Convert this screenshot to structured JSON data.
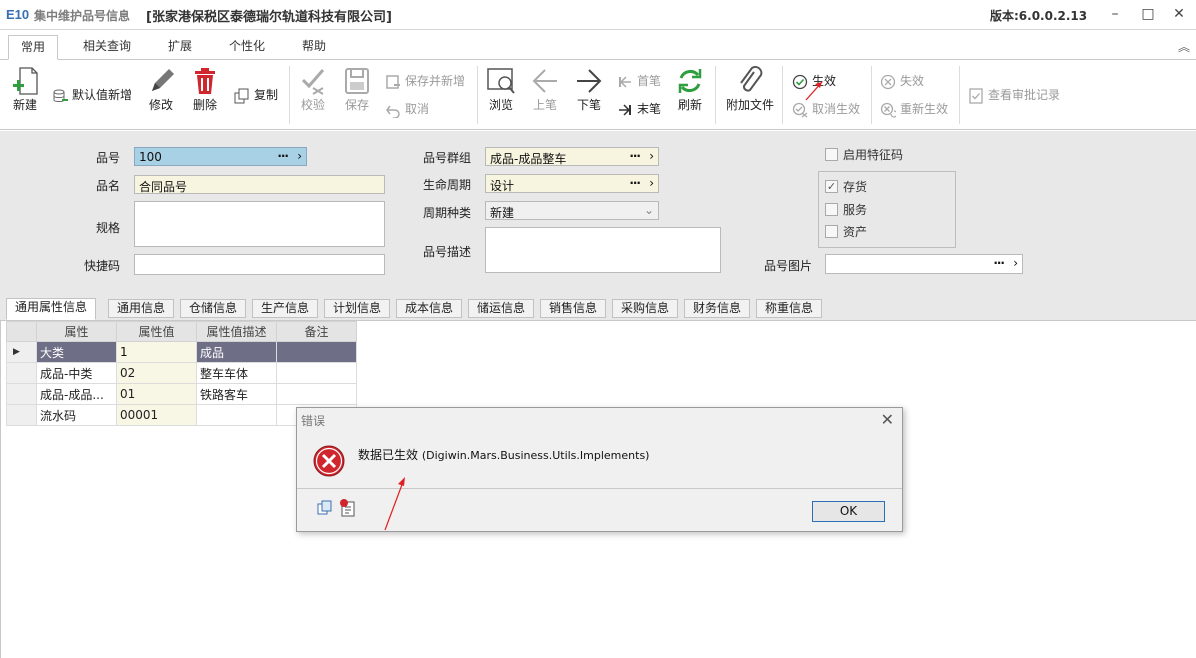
{
  "titlebar": {
    "logo": "E10",
    "app_title": "集中维护品号信息",
    "company": "[张家港保税区泰德瑞尔轨道科技有限公司]",
    "version": "版本:6.0.0.2.13",
    "minimize": "–",
    "maximize": "□",
    "close": "✕"
  },
  "menu": {
    "tabs": [
      "常用",
      "相关查询",
      "扩展",
      "个性化",
      "帮助"
    ],
    "active": "常用"
  },
  "ribbon": {
    "new": "新建",
    "default_new": "默认值新增",
    "edit": "修改",
    "delete": "删除",
    "copy": "复制",
    "check": "校验",
    "save": "保存",
    "save_and_new": "保存并新增",
    "cancel": "取消",
    "browse": "浏览",
    "prev": "上笔",
    "next": "下笔",
    "first": "首笔",
    "last": "末笔",
    "refresh": "刷新",
    "attach": "附加文件",
    "activate": "生效",
    "cancel_activate": "取消生效",
    "invalidate": "失效",
    "reactivate": "重新生效",
    "view_approval": "查看审批记录"
  },
  "form": {
    "item_no_label": "品号",
    "item_no_value": "100",
    "item_name_label": "品名",
    "item_name_value": "合同品号",
    "spec_label": "规格",
    "spec_value": "",
    "shortcut_label": "快捷码",
    "shortcut_value": "",
    "group_label": "品号群组",
    "group_value": "成品-成品整车",
    "lifecycle_label": "生命周期",
    "lifecycle_value": "设计",
    "cycle_type_label": "周期种类",
    "cycle_type_value": "新建",
    "desc_label": "品号描述",
    "desc_value": "",
    "feature_code_label": "启用特征码",
    "feature_code_checked": false,
    "inventory_label": "存货",
    "inventory_checked": true,
    "service_label": "服务",
    "service_checked": false,
    "asset_label": "资产",
    "asset_checked": false,
    "image_label": "品号图片",
    "image_value": ""
  },
  "subtabs": [
    "通用属性信息",
    "通用信息",
    "仓储信息",
    "生产信息",
    "计划信息",
    "成本信息",
    "储运信息",
    "销售信息",
    "采购信息",
    "财务信息",
    "称重信息"
  ],
  "grid": {
    "headers": [
      "属性",
      "属性值",
      "属性值描述",
      "备注"
    ],
    "rows": [
      {
        "marker": "▶",
        "attr": "大类",
        "value": "1",
        "desc": "成品",
        "note": ""
      },
      {
        "marker": "",
        "attr": "成品-中类",
        "value": "02",
        "desc": "整车车体",
        "note": ""
      },
      {
        "marker": "",
        "attr": "成品-成品...",
        "value": "01",
        "desc": "铁路客车",
        "note": ""
      },
      {
        "marker": "",
        "attr": "流水码",
        "value": "00001",
        "desc": "",
        "note": ""
      }
    ]
  },
  "dialog": {
    "title": "错误",
    "message": "数据已生效",
    "source": "(Digiwin.Mars.Business.Utils.Implements)",
    "ok": "OK"
  },
  "colors": {
    "accent": "#3a6fb0",
    "selected_row": "#6e6e86",
    "error_red": "#d0262d",
    "annotation_arrow": "#e02020"
  }
}
